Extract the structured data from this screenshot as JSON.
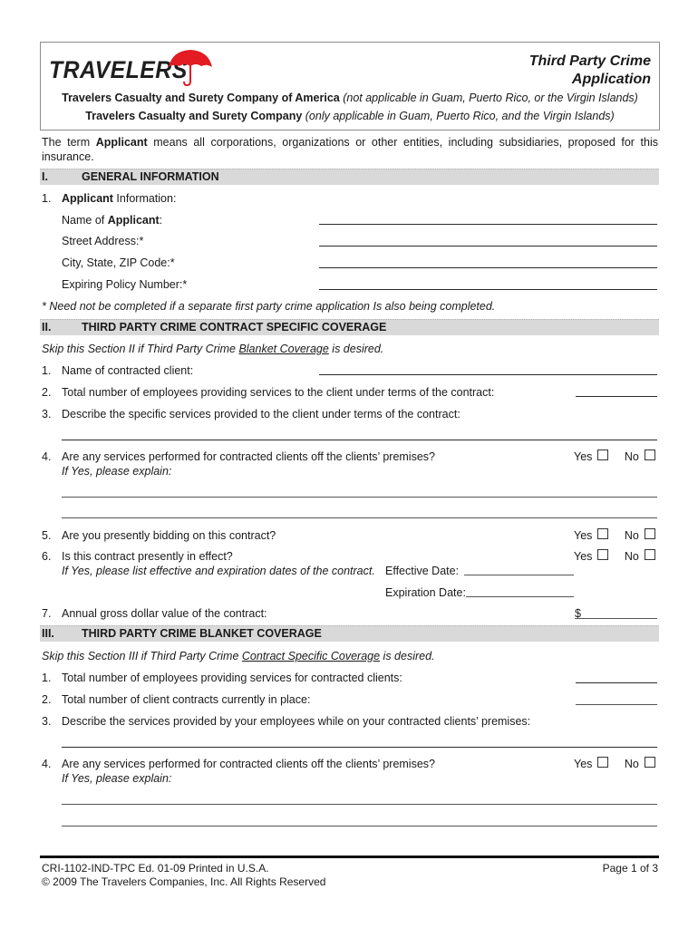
{
  "header": {
    "logo_text": "TRAVELERS",
    "logo_icon": "umbrella-icon",
    "brand_color": "#E31B23",
    "title_line1": "Third Party Crime",
    "title_line2": "Application",
    "company1_name": "Travelers Casualty and Surety Company of America",
    "company1_note": "(not applicable in Guam, Puerto Rico, or the Virgin Islands)",
    "company2_name": "Travelers Casualty and Surety Company",
    "company2_note": "(only applicable in Guam, Puerto Rico, and the Virgin Islands)"
  },
  "intro": {
    "prefix": "The term ",
    "term": "Applicant",
    "suffix": " means all corporations, organizations or other entities, including subsidiaries, proposed for this insurance."
  },
  "section1": {
    "number": "I.",
    "title": "GENERAL INFORMATION",
    "q1_number": "1.",
    "q1_bold": "Applicant",
    "q1_rest": " Information:",
    "fields": [
      {
        "label_prefix": "Name of ",
        "label_bold": "Applicant",
        "label_suffix": ":",
        "value": ""
      },
      {
        "label_prefix": "Street Address:*",
        "label_bold": "",
        "label_suffix": "",
        "value": ""
      },
      {
        "label_prefix": "City, State, ZIP Code:*",
        "label_bold": "",
        "label_suffix": "",
        "value": ""
      },
      {
        "label_prefix": "Expiring Policy Number:*",
        "label_bold": "",
        "label_suffix": "",
        "value": ""
      }
    ],
    "footnote": "* Need not be completed if a separate first party crime application Is also being completed."
  },
  "section2": {
    "number": "II.",
    "title": "THIRD PARTY CRIME CONTRACT SPECIFIC COVERAGE",
    "skip_prefix": "Skip this Section II if Third Party Crime ",
    "skip_link": "Blanket Coverage",
    "skip_suffix": " is desired.",
    "questions": [
      {
        "num": "1.",
        "text": "Name of contracted client:"
      },
      {
        "num": "2.",
        "text": "Total number of employees providing services to the client under terms of the contract:"
      },
      {
        "num": "3.",
        "text": "Describe the specific services provided to the client under terms of the contract:"
      },
      {
        "num": "4.",
        "text": "Are any services performed for contracted clients off the clients’ premises?",
        "sub": "If Yes, please explain:"
      },
      {
        "num": "5.",
        "text": "Are you presently bidding on this contract?"
      },
      {
        "num": "6.",
        "text": "Is this contract presently in effect?",
        "sub": "If Yes, please list effective and expiration dates of the contract."
      },
      {
        "num": "7.",
        "text": "Annual gross dollar value of the contract:"
      }
    ],
    "effective_date_label": "Effective Date:",
    "expiration_date_label": "Expiration Date:",
    "dollar_sign": "$"
  },
  "section3": {
    "number": "III.",
    "title": "THIRD PARTY CRIME BLANKET COVERAGE",
    "skip_prefix": "Skip this Section III if Third Party Crime ",
    "skip_link": "Contract Specific Coverage",
    "skip_suffix": " is desired.",
    "questions": [
      {
        "num": "1.",
        "text": "Total number of employees providing services for contracted clients:"
      },
      {
        "num": "2.",
        "text": "Total number of client contracts currently in place:"
      },
      {
        "num": "3.",
        "text": "Describe the services provided by your employees while on your contracted clients’ premises:"
      },
      {
        "num": "4.",
        "text": "Are any services performed for contracted clients off the clients’ premises?",
        "sub": "If Yes, please explain:"
      }
    ]
  },
  "checkbox": {
    "yes_label": "Yes",
    "no_label": "No"
  },
  "footer": {
    "form_id": "CRI-1102-IND-TPC Ed. 01-09 Printed in U.S.A.",
    "copyright": "© 2009 The Travelers Companies, Inc. All Rights Reserved",
    "page": "Page 1 of 3"
  }
}
